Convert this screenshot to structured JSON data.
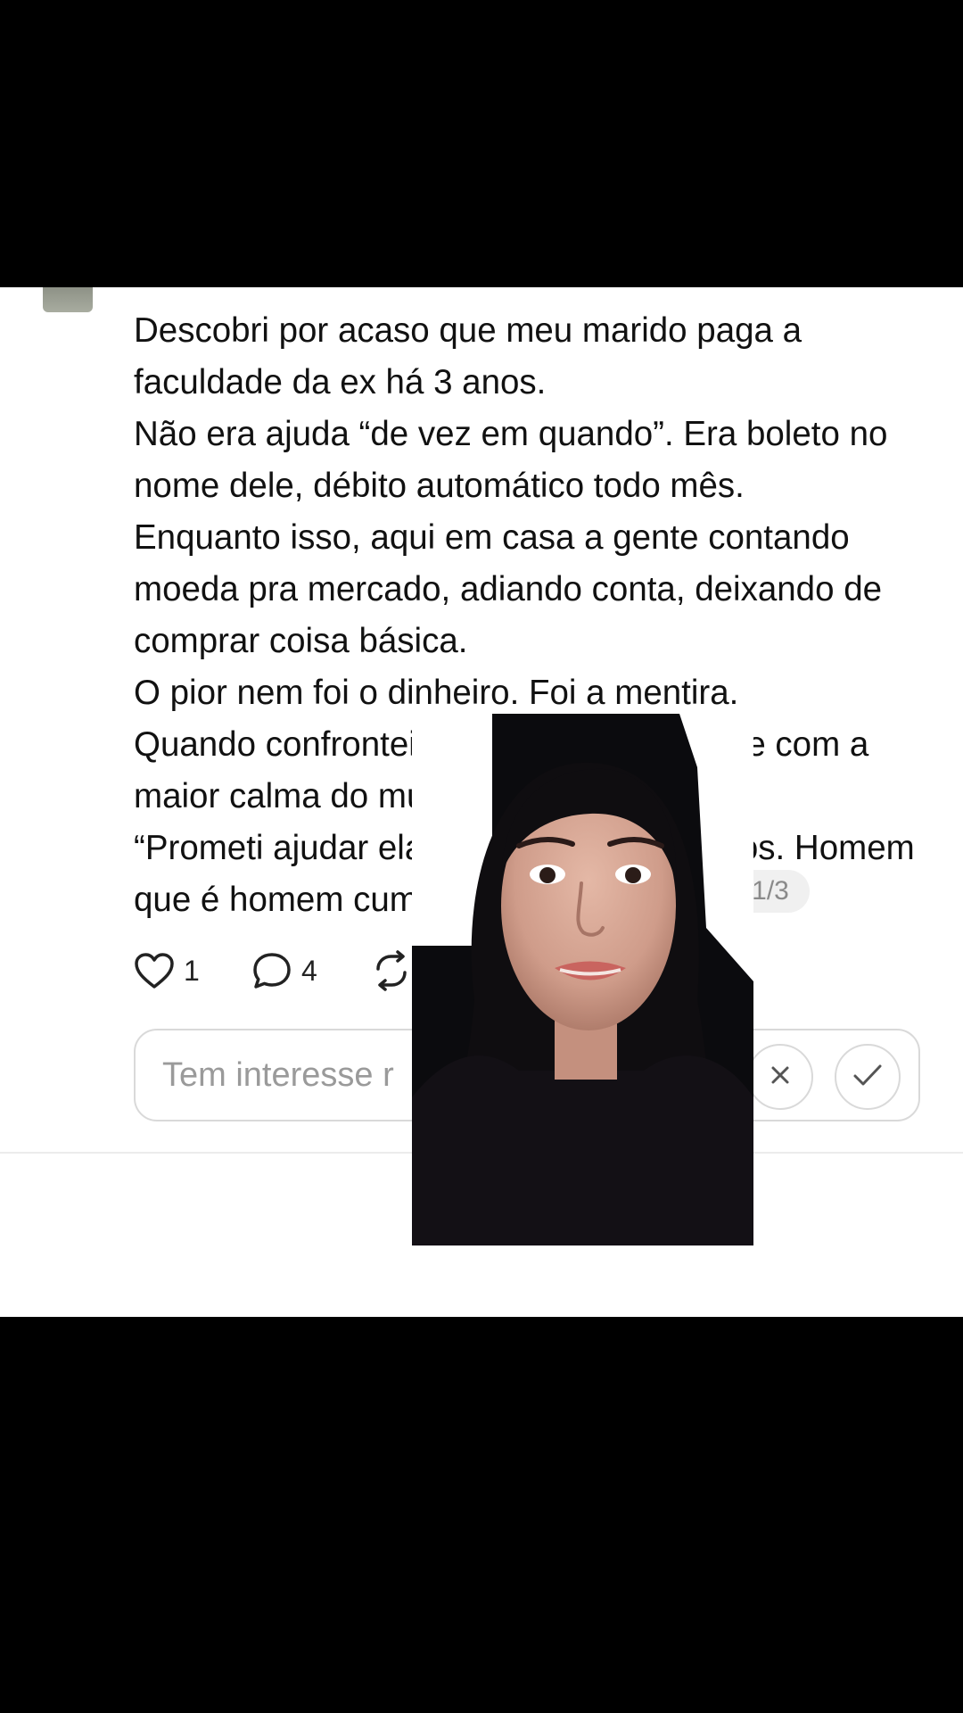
{
  "post": {
    "lines": [
      "Descobri por acaso que meu marido paga a",
      "faculdade da ex há 3 anos.",
      "Não era ajuda “de vez em quando”. Era boleto no",
      "nome dele, débito automático todo mês.",
      "Enquanto isso, aqui em casa a gente contando",
      "moeda pra mercado, adiando conta, deixando de",
      "comprar coisa básica.",
      "O pior nem foi o dinheiro. Foi a mentira.",
      "Quando confrontei, ele nã",
      "maior calma do mundo",
      "“Prometi ajudar ela qu",
      "que é homem cumpre"
    ],
    "line_tails": {
      "line9": ". Disse com a",
      "line11": "mos. Homem"
    },
    "page_indicator": "1/3"
  },
  "actions": {
    "like_count": "1",
    "reply_count": "4"
  },
  "reply": {
    "placeholder": "Tem interesse r"
  },
  "icons": {
    "like": "heart-icon",
    "reply": "comment-bubble-icon",
    "repost": "repost-icon",
    "dismiss": "close-icon",
    "confirm": "checkmark-icon"
  },
  "colors": {
    "background_frame": "#000000",
    "card": "#ffffff",
    "text": "#111111",
    "muted": "#9a9a9a"
  }
}
